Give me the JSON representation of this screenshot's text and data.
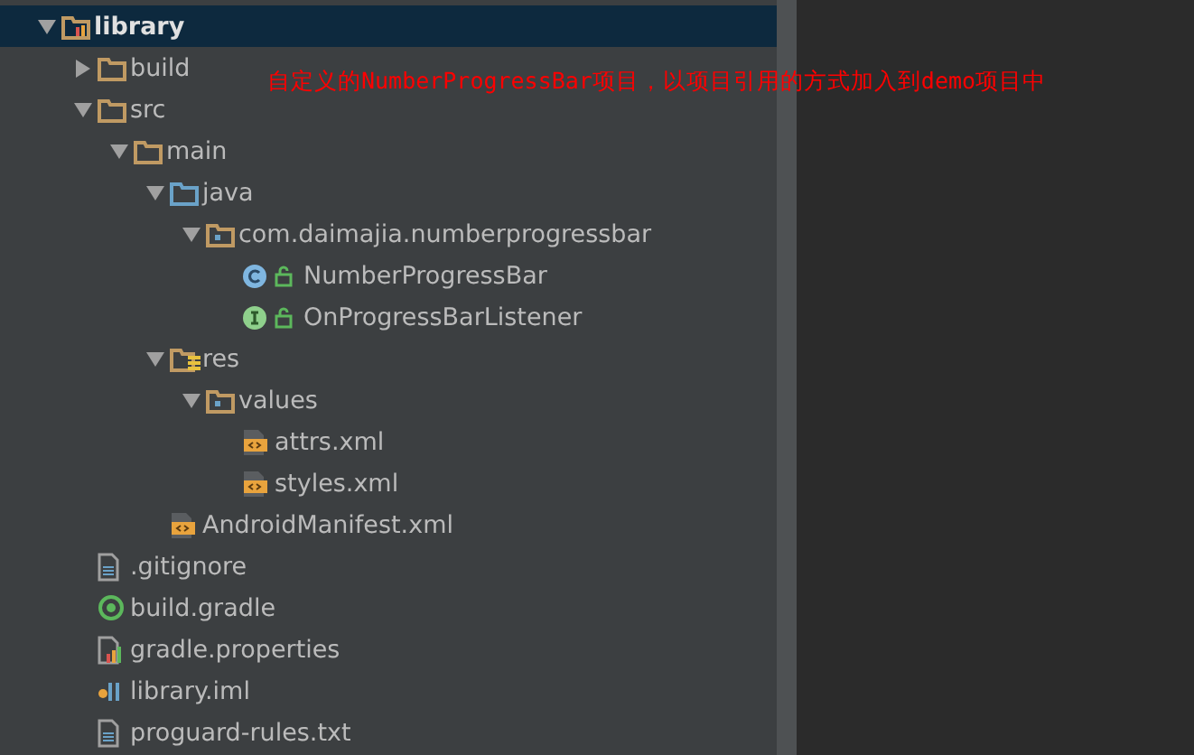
{
  "tree": [
    {
      "label": "library",
      "kind": "module",
      "expanded": true,
      "selected": true,
      "children": [
        {
          "label": "build",
          "kind": "folder",
          "expanded": false,
          "selected": false
        },
        {
          "label": "src",
          "kind": "folder",
          "expanded": true,
          "selected": false,
          "children": [
            {
              "label": "main",
              "kind": "folder",
              "expanded": true,
              "selected": false,
              "children": [
                {
                  "label": "java",
                  "kind": "source-folder",
                  "expanded": true,
                  "selected": false,
                  "children": [
                    {
                      "label": "com.daimajia.numberprogressbar",
                      "kind": "package",
                      "expanded": true,
                      "selected": false,
                      "children": [
                        {
                          "label": "NumberProgressBar",
                          "kind": "class",
                          "selected": false
                        },
                        {
                          "label": "OnProgressBarListener",
                          "kind": "interface",
                          "selected": false
                        }
                      ]
                    }
                  ]
                },
                {
                  "label": "res",
                  "kind": "resource-folder",
                  "expanded": true,
                  "selected": false,
                  "children": [
                    {
                      "label": "values",
                      "kind": "package",
                      "expanded": true,
                      "selected": false,
                      "children": [
                        {
                          "label": "attrs.xml",
                          "kind": "xml",
                          "selected": false
                        },
                        {
                          "label": "styles.xml",
                          "kind": "xml",
                          "selected": false
                        }
                      ]
                    }
                  ]
                },
                {
                  "label": "AndroidManifest.xml",
                  "kind": "xml",
                  "selected": false
                }
              ]
            }
          ]
        },
        {
          "label": ".gitignore",
          "kind": "text",
          "selected": false
        },
        {
          "label": "build.gradle",
          "kind": "gradle",
          "selected": false
        },
        {
          "label": "gradle.properties",
          "kind": "properties",
          "selected": false
        },
        {
          "label": "library.iml",
          "kind": "iml",
          "selected": false
        },
        {
          "label": "proguard-rules.txt",
          "kind": "text",
          "selected": false
        }
      ]
    }
  ],
  "annotation": "自定义的NumberProgressBar项目，以项目引用的方式加入到demo项目中"
}
